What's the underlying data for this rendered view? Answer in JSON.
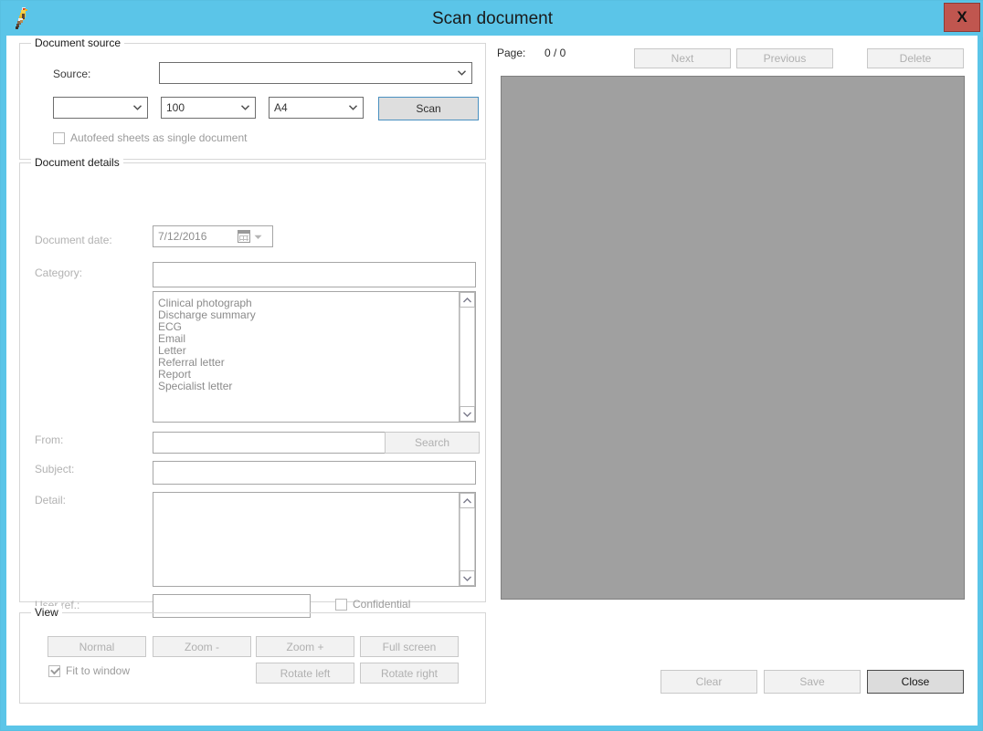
{
  "window": {
    "title": "Scan document",
    "close_label": "X",
    "icon": "bird-icon",
    "titlebar_color": "#5bc5e8",
    "close_color": "#c0564f"
  },
  "document_source": {
    "title": "Document source",
    "source_label": "Source:",
    "source_value": "",
    "device_value": "",
    "resolution_value": "100",
    "papersize_value": "A4",
    "scan_label": "Scan",
    "autofeed_label": "Autofeed sheets as single document",
    "autofeed_checked": false
  },
  "document_details": {
    "title": "Document details",
    "date_label": "Document date:",
    "date_value": "7/12/2016",
    "category_label": "Category:",
    "category_value": "",
    "categories": [
      "Clinical photograph",
      "Discharge summary",
      "ECG",
      "Email",
      "Letter",
      "Referral letter",
      "Report",
      "Specialist letter"
    ],
    "from_label": "From:",
    "from_value": "",
    "search_label": "Search",
    "subject_label": "Subject:",
    "subject_value": "",
    "detail_label": "Detail:",
    "detail_value": "",
    "userref_label": "User ref.:",
    "userref_value": "",
    "confidential_label": "Confidential",
    "confidential_checked": false
  },
  "view": {
    "title": "View",
    "normal_label": "Normal",
    "zoom_out_label": "Zoom -",
    "zoom_in_label": "Zoom +",
    "fullscreen_label": "Full screen",
    "rotate_left_label": "Rotate left",
    "rotate_right_label": "Rotate right",
    "fit_label": "Fit to window",
    "fit_checked": true
  },
  "pages": {
    "page_label": "Page:",
    "page_value": "0 / 0",
    "next_label": "Next",
    "previous_label": "Previous",
    "delete_label": "Delete",
    "preview_color": "#a0a0a0"
  },
  "actions": {
    "clear_label": "Clear",
    "save_label": "Save",
    "close_label": "Close"
  }
}
